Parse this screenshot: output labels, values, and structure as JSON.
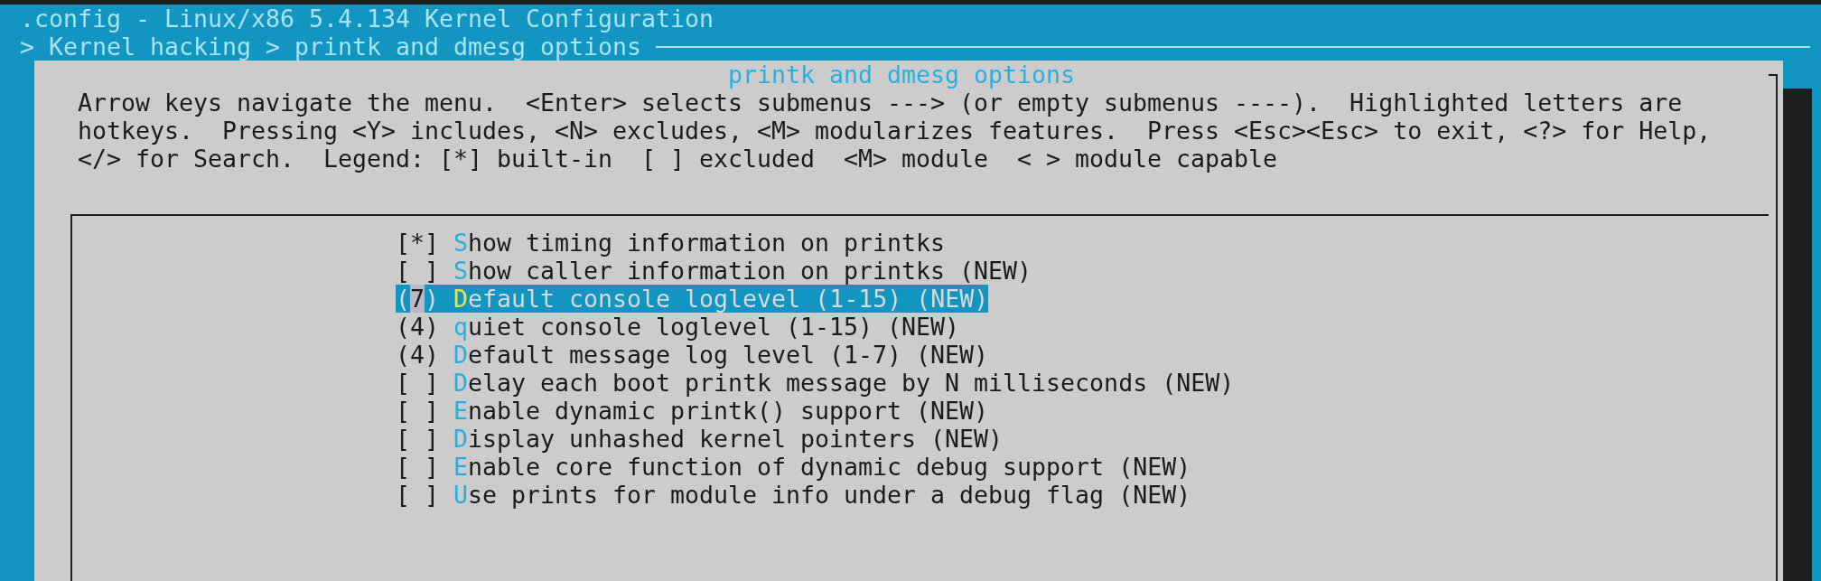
{
  "window": {
    "title": ".config - Linux/x86 5.4.134 Kernel Configuration"
  },
  "breadcrumb": "> Kernel hacking > printk and dmesg options",
  "dialog": {
    "title": "printk and dmesg options",
    "help_lines": [
      "Arrow keys navigate the menu.  <Enter> selects submenus ---> (or empty submenus ----).  Highlighted letters are",
      "hotkeys.  Pressing <Y> includes, <N> excludes, <M> modularizes features.  Press <Esc><Esc> to exit, <?> for Help,",
      "</> for Search.  Legend: [*] built-in  [ ] excluded  <M> module  < > module capable"
    ]
  },
  "menu": {
    "items": [
      {
        "prefix": "[*]",
        "hotkey": "S",
        "rest": "how timing information on printks",
        "selected": false
      },
      {
        "prefix": "[ ]",
        "hotkey": "S",
        "rest": "how caller information on printks (NEW)",
        "selected": false
      },
      {
        "prefix": "(7)",
        "hotkey": "D",
        "rest": "efault console loglevel (1-15) (NEW)",
        "selected": true
      },
      {
        "prefix": "(4)",
        "hotkey": "q",
        "rest": "uiet console loglevel (1-15) (NEW)",
        "selected": false
      },
      {
        "prefix": "(4)",
        "hotkey": "D",
        "rest": "efault message log level (1-7) (NEW)",
        "selected": false
      },
      {
        "prefix": "[ ]",
        "hotkey": "D",
        "rest": "elay each boot printk message by N milliseconds (NEW)",
        "selected": false
      },
      {
        "prefix": "[ ]",
        "hotkey": "E",
        "rest": "nable dynamic printk() support (NEW)",
        "selected": false
      },
      {
        "prefix": "[ ]",
        "hotkey": "D",
        "rest": "isplay unhashed kernel pointers (NEW)",
        "selected": false
      },
      {
        "prefix": "[ ]",
        "hotkey": "E",
        "rest": "nable core function of dynamic debug support (NEW)",
        "selected": false
      },
      {
        "prefix": "[ ]",
        "hotkey": "U",
        "rest": "se prints for module info under a debug flag (NEW)",
        "selected": false
      }
    ]
  }
}
